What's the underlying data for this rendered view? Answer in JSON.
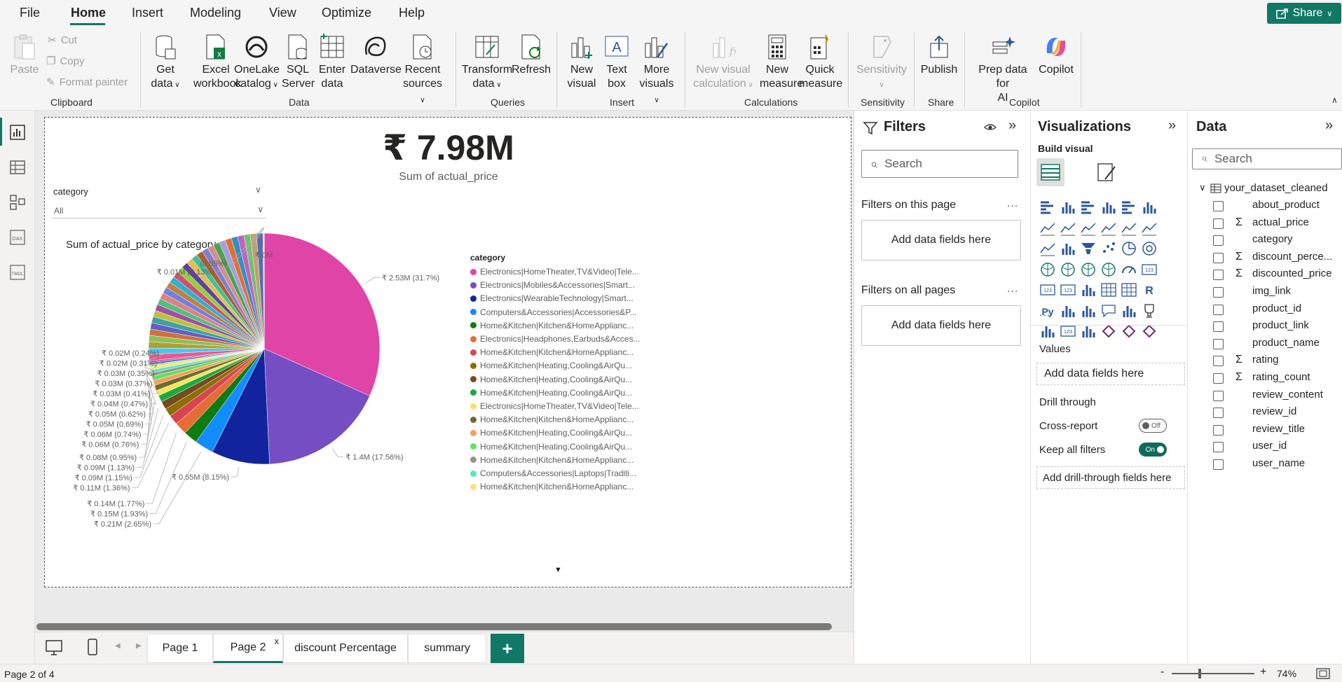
{
  "menu": {
    "items": [
      "File",
      "Home",
      "Insert",
      "Modeling",
      "View",
      "Optimize",
      "Help"
    ],
    "active": "Home",
    "share_label": "Share"
  },
  "ribbon": {
    "clipboard": {
      "paste": "Paste",
      "cut": "Cut",
      "copy": "Copy",
      "format_painter": "Format painter",
      "group": "Clipboard"
    },
    "data": {
      "get_data": [
        "Get",
        "data"
      ],
      "excel": [
        "Excel",
        "workbook"
      ],
      "onelake": [
        "OneLake",
        "catalog"
      ],
      "sql": [
        "SQL",
        "Server"
      ],
      "enter": [
        "Enter",
        "data"
      ],
      "dataverse": "Dataverse",
      "recent": [
        "Recent",
        "sources"
      ],
      "group": "Data"
    },
    "queries": {
      "transform": [
        "Transform",
        "data"
      ],
      "refresh": "Refresh",
      "group": "Queries"
    },
    "insert": {
      "new_visual": [
        "New",
        "visual"
      ],
      "text_box": [
        "Text",
        "box"
      ],
      "more_visuals": [
        "More",
        "visuals"
      ],
      "group": "Insert"
    },
    "calculations": {
      "new_visual_calc": [
        "New visual",
        "calculation"
      ],
      "new_measure": [
        "New",
        "measure"
      ],
      "quick_measure": [
        "Quick",
        "measure"
      ],
      "group": "Calculations"
    },
    "sensitivity": {
      "label": "Sensitivity",
      "group": "Sensitivity"
    },
    "share": {
      "publish": "Publish",
      "group": "Share"
    },
    "copilot": {
      "prep": [
        "Prep data for",
        "AI"
      ],
      "copilot": "Copilot",
      "group": "Copilot"
    }
  },
  "card": {
    "value": "₹ 7.98M",
    "label": "Sum of actual_price"
  },
  "slicer": {
    "title": "category",
    "value": "All"
  },
  "chart_data": {
    "type": "pie",
    "title": "Sum of actual_price by category",
    "total": "₹ 7.98M",
    "slices": [
      {
        "label": "Electronics|HomeTheater,TV&Video|Tele...",
        "value": 2.53,
        "percent": 31.7,
        "display": "₹ 2.53M (31.7%)",
        "color": "#e044a7"
      },
      {
        "label": "Electronics|Mobiles&Accessories|Smart...",
        "value": 1.4,
        "percent": 17.56,
        "display": "₹ 1.4M (17.56%)",
        "color": "#744ec2"
      },
      {
        "label": "Electronics|WearableTechnology|Smart...",
        "value": 0.65,
        "percent": 8.15,
        "display": "₹ 0.65M (8.15%)",
        "color": "#12239e"
      },
      {
        "label": "Computers&Accessories|Accessories&P...",
        "value": 0.21,
        "percent": 2.65,
        "display": "₹ 0.21M (2.65%)",
        "color": "#118dff"
      },
      {
        "label": "Home&Kitchen|Kitchen&HomeApplianc...",
        "value": 0.15,
        "percent": 1.93,
        "display": "₹ 0.15M (1.93%)",
        "color": "#107c10"
      },
      {
        "label": "Electronics|Headphones,Earbuds&Acces...",
        "value": 0.14,
        "percent": 1.77,
        "display": "₹ 0.14M (1.77%)",
        "color": "#e66c37"
      },
      {
        "label": "Home&Kitchen|Kitchen&HomeApplianc...",
        "value": 0.11,
        "percent": 1.36,
        "display": "₹ 0.11M (1.36%)",
        "color": "#d64550"
      },
      {
        "label": "Home&Kitchen|Heating,Cooling&AirQu...",
        "value": 0.09,
        "percent": 1.15,
        "display": "₹ 0.09M (1.15%)",
        "color": "#8d6e00"
      },
      {
        "label": "Home&Kitchen|Heating,Cooling&AirQu...",
        "value": 0.09,
        "percent": 1.13,
        "display": "₹ 0.09M (1.13%)",
        "color": "#744a1e"
      },
      {
        "label": "Home&Kitchen|Heating,Cooling&AirQu...",
        "value": 0.08,
        "percent": 0.95,
        "display": "₹ 0.08M (0.95%)",
        "color": "#1aab40"
      },
      {
        "label": "Electronics|HomeTheater,TV&Video|Tele...",
        "value": 0.06,
        "percent": 0.76,
        "display": "₹ 0.06M (0.76%)",
        "color": "#f5e35a"
      },
      {
        "label": "Home&Kitchen|Kitchen&HomeApplianc...",
        "value": 0.06,
        "percent": 0.74,
        "display": "₹ 0.06M (0.74%)",
        "color": "#6b6b2f"
      },
      {
        "label": "Home&Kitchen|Heating,Cooling&AirQu...",
        "value": 0.05,
        "percent": 0.69,
        "display": "₹ 0.05M (0.69%)",
        "color": "#f7a05b"
      },
      {
        "label": "Home&Kitchen|Heating,Cooling&AirQu...",
        "value": 0.05,
        "percent": 0.62,
        "display": "₹ 0.05M (0.62%)",
        "color": "#5be65b"
      },
      {
        "label": "Home&Kitchen|Kitchen&HomeApplianc...",
        "value": 0.04,
        "percent": 0.47,
        "display": "₹ 0.04M (0.47%)",
        "color": "#9b9087"
      },
      {
        "label": "Computers&Accessories|Laptops|Traditi...",
        "value": 0.03,
        "percent": 0.41,
        "display": "₹ 0.03M (0.41%)",
        "color": "#4bebc6"
      },
      {
        "label": "Home&Kitchen|Kitchen&HomeApplianc...",
        "value": 0.03,
        "percent": 0.37,
        "display": "₹ 0.03M (0.37%)",
        "color": "#fde07e"
      },
      {
        "label": "",
        "value": 0.03,
        "percent": 0.35,
        "display": "₹ 0.03M (0.35%)",
        "color": "#c0ef7c"
      },
      {
        "label": "",
        "value": 0.02,
        "percent": 0.31,
        "display": "₹ 0.02M (0.31%)",
        "color": "#5d63d6"
      },
      {
        "label": "",
        "value": 0.02,
        "percent": 0.24,
        "display": "₹ 0.02M (0.24%)",
        "color": "#c4509b"
      },
      {
        "label": "",
        "value": 0.01,
        "percent": 0.13,
        "display": "₹ 0.01M (0.13%)",
        "color": "#ff9b3f"
      },
      {
        "label": "",
        "value": 0.0,
        "percent": 0.05,
        "display": "(0.05%)",
        "color": "#3a3ad4"
      },
      {
        "label": "",
        "value": 0.0,
        "percent": 0.0,
        "display": "₹ 0M",
        "color": "#4b4bcf"
      }
    ],
    "remainder_colors": [
      "#e85a8c",
      "#49c6f0",
      "#b0a030",
      "#8fbf5a",
      "#d07040",
      "#6060c0",
      "#40a0a0",
      "#c0c040",
      "#a050a0",
      "#50c080",
      "#e08080",
      "#7080e0",
      "#c08040",
      "#30b0d0",
      "#d05070",
      "#90d040",
      "#6040a0",
      "#e0c050",
      "#40c0a0",
      "#b06030",
      "#8080d0",
      "#d09090",
      "#50a050",
      "#a0a0e0",
      "#e07030",
      "#3090c0",
      "#c060c0",
      "#70c070",
      "#c0a070",
      "#5070b0"
    ],
    "legend_title": "category",
    "legend_more": "▼"
  },
  "pages": {
    "tabs": [
      "Page 1",
      "Page 2",
      "discount Percentage",
      "summary"
    ],
    "active": "Page 2",
    "close_mark": "x",
    "add_label": "+"
  },
  "status": {
    "text": "Page 2 of 4",
    "zoom": "74%",
    "zoom_minus": "-",
    "zoom_plus": "+"
  },
  "filters": {
    "title": "Filters",
    "search_placeholder": "Search",
    "on_page": "Filters on this page",
    "on_all": "Filters on all pages",
    "add_fields": "Add data fields here",
    "more": "..."
  },
  "visualizations": {
    "title": "Visualizations",
    "build_visual": "Build visual",
    "more": "...",
    "r_label": "R",
    "py_label": "Py",
    "values_label": "Values",
    "add_data_fields": "Add data fields here",
    "drill_through": "Drill through",
    "cross_report": "Cross-report",
    "cross_report_state": "Off",
    "keep_all_filters": "Keep all filters",
    "keep_all_state": "On",
    "add_drill_fields": "Add drill-through fields here"
  },
  "data": {
    "title": "Data",
    "search_placeholder": "Search",
    "table": "your_dataset_cleaned",
    "fields": [
      {
        "name": "about_product",
        "sigma": false
      },
      {
        "name": "actual_price",
        "sigma": true
      },
      {
        "name": "category",
        "sigma": false
      },
      {
        "name": "discount_perce...",
        "sigma": true
      },
      {
        "name": "discounted_price",
        "sigma": true
      },
      {
        "name": "img_link",
        "sigma": false
      },
      {
        "name": "product_id",
        "sigma": false
      },
      {
        "name": "product_link",
        "sigma": false
      },
      {
        "name": "product_name",
        "sigma": false
      },
      {
        "name": "rating",
        "sigma": true
      },
      {
        "name": "rating_count",
        "sigma": true
      },
      {
        "name": "review_content",
        "sigma": false
      },
      {
        "name": "review_id",
        "sigma": false
      },
      {
        "name": "review_title",
        "sigma": false
      },
      {
        "name": "user_id",
        "sigma": false
      },
      {
        "name": "user_name",
        "sigma": false
      }
    ],
    "sigma_glyph": "Σ"
  },
  "colors": {
    "accent": "#117865",
    "teal_dark": "#0f6b59"
  }
}
